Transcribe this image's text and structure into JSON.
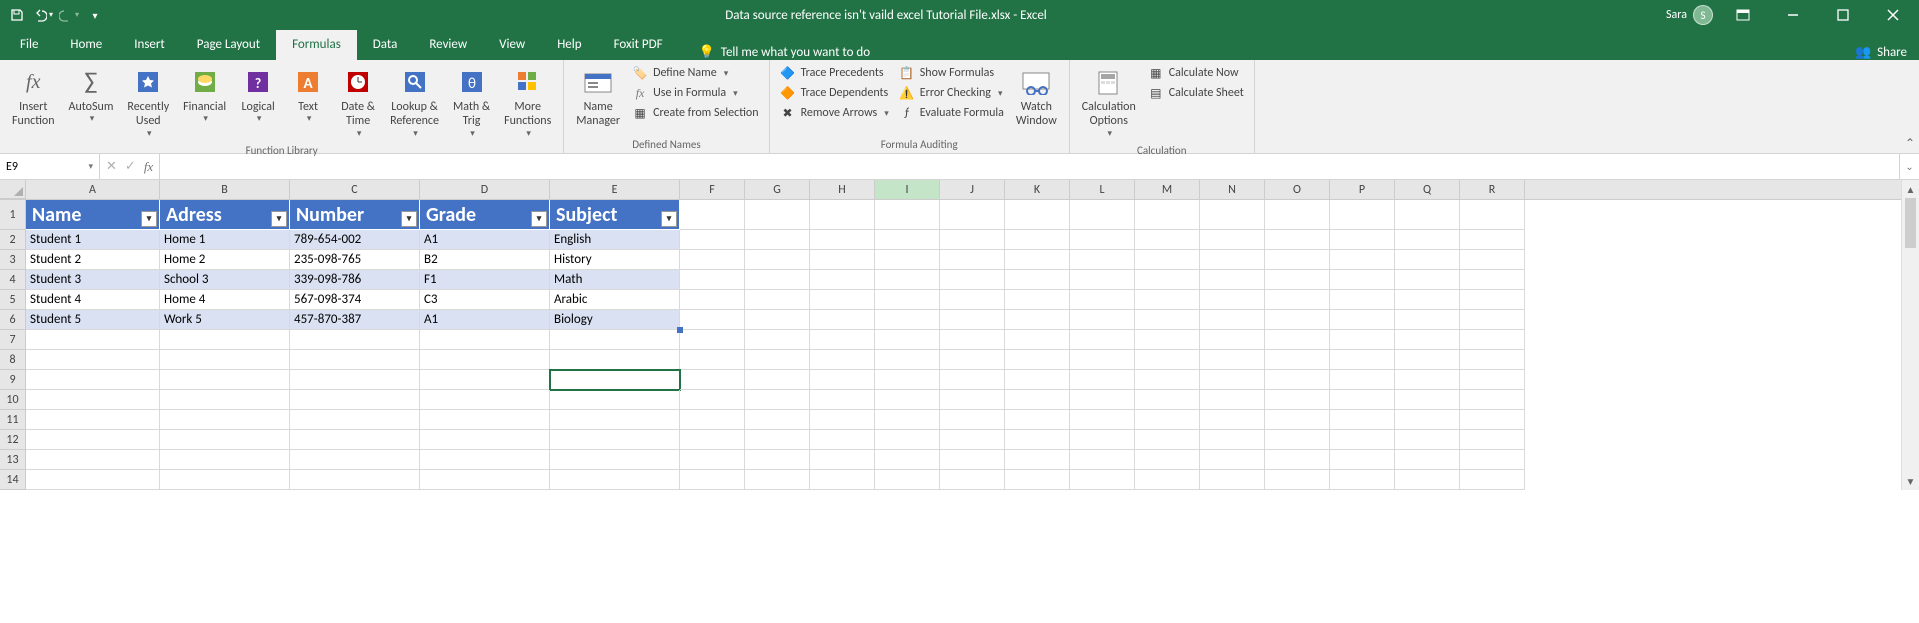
{
  "app": {
    "title": "Data source reference isn't vaild excel Tutorial File.xlsx  -  Excel",
    "user": "Sara",
    "user_initial": "S",
    "share_label": "Share"
  },
  "tabs": {
    "file": "File",
    "home": "Home",
    "insert": "Insert",
    "page_layout": "Page Layout",
    "formulas": "Formulas",
    "data": "Data",
    "review": "Review",
    "view": "View",
    "help": "Help",
    "foxit": "Foxit PDF",
    "tell_me": "Tell me what you want to do"
  },
  "ribbon": {
    "insert_function": "Insert\nFunction",
    "autosum": "AutoSum",
    "recently_used": "Recently\nUsed",
    "financial": "Financial",
    "logical": "Logical",
    "text": "Text",
    "date_time": "Date &\nTime",
    "lookup_ref": "Lookup &\nReference",
    "math_trig": "Math &\nTrig",
    "more_functions": "More\nFunctions",
    "function_library": "Function Library",
    "name_manager": "Name\nManager",
    "define_name": "Define Name",
    "use_in_formula": "Use in Formula",
    "create_from_selection": "Create from Selection",
    "defined_names": "Defined Names",
    "trace_precedents": "Trace Precedents",
    "trace_dependents": "Trace Dependents",
    "remove_arrows": "Remove Arrows",
    "show_formulas": "Show Formulas",
    "error_checking": "Error Checking",
    "evaluate_formula": "Evaluate Formula",
    "formula_auditing": "Formula Auditing",
    "watch_window": "Watch\nWindow",
    "calculation_options": "Calculation\nOptions",
    "calculate_now": "Calculate Now",
    "calculate_sheet": "Calculate Sheet",
    "calculation": "Calculation"
  },
  "formula_bar": {
    "name_box": "E9",
    "formula": ""
  },
  "columns": [
    "A",
    "B",
    "C",
    "D",
    "E",
    "F",
    "G",
    "H",
    "I",
    "J",
    "K",
    "L",
    "M",
    "N",
    "O",
    "P",
    "Q",
    "R"
  ],
  "highlight_col_index": 8,
  "rows": [
    "1",
    "2",
    "3",
    "4",
    "5",
    "6",
    "7",
    "8",
    "9",
    "10",
    "11",
    "12",
    "13",
    "14"
  ],
  "selected_cell": {
    "row": 8,
    "col": 4
  },
  "table": {
    "headers": [
      "Name",
      "Adress",
      "Number",
      "Grade",
      "Subject"
    ],
    "data": [
      [
        "Student 1",
        "Home 1",
        "789-654-002",
        "A1",
        "English"
      ],
      [
        "Student 2",
        "Home 2",
        "235-098-765",
        "B2",
        "History"
      ],
      [
        "Student 3",
        "School 3",
        "339-098-786",
        "F1",
        "Math"
      ],
      [
        "Student 4",
        "Home 4",
        "567-098-374",
        "C3",
        "Arabic"
      ],
      [
        "Student 5",
        "Work 5",
        "457-870-387",
        "A1",
        "Biology"
      ]
    ]
  }
}
